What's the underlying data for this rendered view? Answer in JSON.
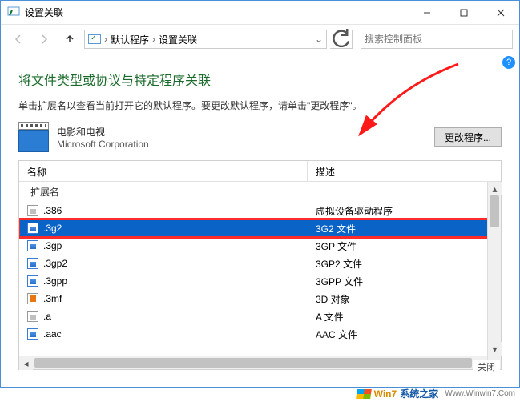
{
  "window": {
    "title": "设置关联"
  },
  "nav": {
    "breadcrumb": {
      "a": "默认程序",
      "b": "设置关联"
    },
    "search_placeholder": "搜索控制面板"
  },
  "content": {
    "heading": "将文件类型或协议与特定程序关联",
    "subtext": "单击扩展名以查看当前打开它的默认程序。要更改默认程序，请单击\"更改程序\"。",
    "program": {
      "name": "电影和电视",
      "vendor": "Microsoft Corporation"
    },
    "change_button": "更改程序..."
  },
  "list": {
    "col_name": "名称",
    "col_desc": "描述",
    "group": "扩展名",
    "rows": [
      {
        "ext": ".386",
        "desc": "虚拟设备驱动程序",
        "icon": "grey"
      },
      {
        "ext": ".3g2",
        "desc": "3G2 文件",
        "icon": "blue",
        "selected": true
      },
      {
        "ext": ".3gp",
        "desc": "3GP 文件",
        "icon": "blue"
      },
      {
        "ext": ".3gp2",
        "desc": "3GP2 文件",
        "icon": "blue"
      },
      {
        "ext": ".3gpp",
        "desc": "3GPP 文件",
        "icon": "blue"
      },
      {
        "ext": ".3mf",
        "desc": "3D 对象",
        "icon": "orange"
      },
      {
        "ext": ".a",
        "desc": "A 文件",
        "icon": "grey"
      },
      {
        "ext": ".aac",
        "desc": "AAC 文件",
        "icon": "blue"
      }
    ]
  },
  "footer": {
    "close": "关闭"
  },
  "watermark": {
    "t1": "Win7",
    "t2": "系统之家",
    "url": "Www.Winwin7.Com"
  }
}
